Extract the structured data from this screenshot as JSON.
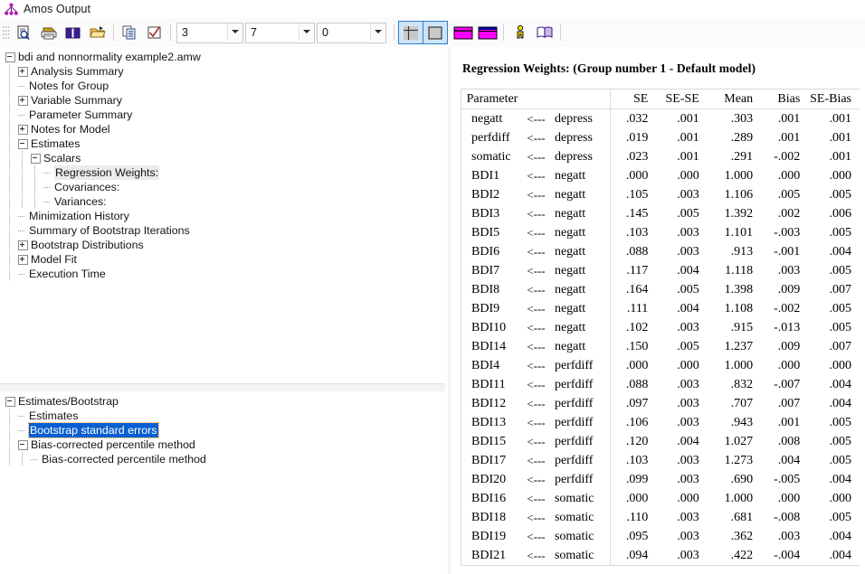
{
  "window": {
    "title": "Amos Output",
    "icon": "amos-path-diagram-icon"
  },
  "toolbar": {
    "buttons": [
      {
        "name": "print-preview-icon",
        "label": "Print Preview"
      },
      {
        "name": "print-icon",
        "label": "Print"
      },
      {
        "name": "book-icon",
        "label": "Help Contents"
      },
      {
        "name": "open-folder-icon",
        "label": "Open File"
      },
      {
        "name": "copy-icon",
        "label": "Copy to Clipboard"
      },
      {
        "name": "checkbox-icon",
        "label": "Options"
      }
    ],
    "combos": [
      {
        "name": "decimal-places-combo",
        "value": "3"
      },
      {
        "name": "significant-digits-combo",
        "value": "7"
      },
      {
        "name": "zero-format-combo",
        "value": "0"
      }
    ],
    "toggles": [
      {
        "name": "tree-view-toggle",
        "icon": "crosshair-icon",
        "selected": true
      },
      {
        "name": "text-view-toggle",
        "icon": "page-icon",
        "selected": true
      },
      {
        "name": "table-format-1-icon",
        "label": "Table Format 1"
      },
      {
        "name": "table-format-2-icon",
        "label": "Table Format 2"
      }
    ],
    "right_buttons": [
      {
        "name": "person-icon",
        "label": "Group"
      },
      {
        "name": "open-book-icon",
        "label": "Model"
      }
    ]
  },
  "tree_top": {
    "items": [
      {
        "label": "bdi and nonnormality example2.amw",
        "depth": 0,
        "marker": "minus"
      },
      {
        "label": "Analysis Summary",
        "depth": 1,
        "marker": "plus"
      },
      {
        "label": "Notes for Group",
        "depth": 1,
        "marker": "leaf"
      },
      {
        "label": "Variable Summary",
        "depth": 1,
        "marker": "plus"
      },
      {
        "label": "Parameter Summary",
        "depth": 1,
        "marker": "leaf"
      },
      {
        "label": "Notes for Model",
        "depth": 1,
        "marker": "plus"
      },
      {
        "label": "Estimates",
        "depth": 1,
        "marker": "minus"
      },
      {
        "label": "Scalars",
        "depth": 2,
        "marker": "minus"
      },
      {
        "label": "Regression Weights:",
        "depth": 3,
        "marker": "leaf",
        "state": "shaded"
      },
      {
        "label": "Covariances:",
        "depth": 3,
        "marker": "leaf"
      },
      {
        "label": "Variances:",
        "depth": 3,
        "marker": "leaf"
      },
      {
        "label": "Minimization History",
        "depth": 1,
        "marker": "leaf"
      },
      {
        "label": "Summary of Bootstrap Iterations",
        "depth": 1,
        "marker": "leaf"
      },
      {
        "label": "Bootstrap Distributions",
        "depth": 1,
        "marker": "plus"
      },
      {
        "label": "Model Fit",
        "depth": 1,
        "marker": "plus"
      },
      {
        "label": "Execution Time",
        "depth": 1,
        "marker": "leaf"
      }
    ]
  },
  "tree_bottom": {
    "items": [
      {
        "label": "Estimates/Bootstrap",
        "depth": 0,
        "marker": "minus"
      },
      {
        "label": "Estimates",
        "depth": 1,
        "marker": "leaf"
      },
      {
        "label": "Bootstrap standard errors",
        "depth": 1,
        "marker": "leaf",
        "state": "selected"
      },
      {
        "label": "Bias-corrected percentile method",
        "depth": 1,
        "marker": "minus"
      },
      {
        "label": "Bias-corrected percentile method",
        "depth": 2,
        "marker": "leaf"
      }
    ]
  },
  "output": {
    "heading": "Regression Weights: (Group number 1 - Default model)",
    "table": {
      "headers": [
        "Parameter",
        "",
        "",
        "SE",
        "SE-SE",
        "Mean",
        "Bias",
        "SE-Bias"
      ],
      "arrow": "<---",
      "rows": [
        {
          "from": "negatt",
          "to": "depress",
          "se": ".032",
          "sese": ".001",
          "mean": ".303",
          "bias": ".001",
          "sebias": ".001"
        },
        {
          "from": "perfdiff",
          "to": "depress",
          "se": ".019",
          "sese": ".001",
          "mean": ".289",
          "bias": ".001",
          "sebias": ".001"
        },
        {
          "from": "somatic",
          "to": "depress",
          "se": ".023",
          "sese": ".001",
          "mean": ".291",
          "bias": "-.002",
          "sebias": ".001"
        },
        {
          "from": "BDI1",
          "to": "negatt",
          "se": ".000",
          "sese": ".000",
          "mean": "1.000",
          "bias": ".000",
          "sebias": ".000"
        },
        {
          "from": "BDI2",
          "to": "negatt",
          "se": ".105",
          "sese": ".003",
          "mean": "1.106",
          "bias": ".005",
          "sebias": ".005"
        },
        {
          "from": "BDI3",
          "to": "negatt",
          "se": ".145",
          "sese": ".005",
          "mean": "1.392",
          "bias": ".002",
          "sebias": ".006"
        },
        {
          "from": "BDI5",
          "to": "negatt",
          "se": ".103",
          "sese": ".003",
          "mean": "1.101",
          "bias": "-.003",
          "sebias": ".005"
        },
        {
          "from": "BDI6",
          "to": "negatt",
          "se": ".088",
          "sese": ".003",
          "mean": ".913",
          "bias": "-.001",
          "sebias": ".004"
        },
        {
          "from": "BDI7",
          "to": "negatt",
          "se": ".117",
          "sese": ".004",
          "mean": "1.118",
          "bias": ".003",
          "sebias": ".005"
        },
        {
          "from": "BDI8",
          "to": "negatt",
          "se": ".164",
          "sese": ".005",
          "mean": "1.398",
          "bias": ".009",
          "sebias": ".007"
        },
        {
          "from": "BDI9",
          "to": "negatt",
          "se": ".111",
          "sese": ".004",
          "mean": "1.108",
          "bias": "-.002",
          "sebias": ".005"
        },
        {
          "from": "BDI10",
          "to": "negatt",
          "se": ".102",
          "sese": ".003",
          "mean": ".915",
          "bias": "-.013",
          "sebias": ".005"
        },
        {
          "from": "BDI14",
          "to": "negatt",
          "se": ".150",
          "sese": ".005",
          "mean": "1.237",
          "bias": ".009",
          "sebias": ".007"
        },
        {
          "from": "BDI4",
          "to": "perfdiff",
          "se": ".000",
          "sese": ".000",
          "mean": "1.000",
          "bias": ".000",
          "sebias": ".000"
        },
        {
          "from": "BDI11",
          "to": "perfdiff",
          "se": ".088",
          "sese": ".003",
          "mean": ".832",
          "bias": "-.007",
          "sebias": ".004"
        },
        {
          "from": "BDI12",
          "to": "perfdiff",
          "se": ".097",
          "sese": ".003",
          "mean": ".707",
          "bias": ".007",
          "sebias": ".004"
        },
        {
          "from": "BDI13",
          "to": "perfdiff",
          "se": ".106",
          "sese": ".003",
          "mean": ".943",
          "bias": ".001",
          "sebias": ".005"
        },
        {
          "from": "BDI15",
          "to": "perfdiff",
          "se": ".120",
          "sese": ".004",
          "mean": "1.027",
          "bias": ".008",
          "sebias": ".005"
        },
        {
          "from": "BDI17",
          "to": "perfdiff",
          "se": ".103",
          "sese": ".003",
          "mean": "1.273",
          "bias": ".004",
          "sebias": ".005"
        },
        {
          "from": "BDI20",
          "to": "perfdiff",
          "se": ".099",
          "sese": ".003",
          "mean": ".690",
          "bias": "-.005",
          "sebias": ".004"
        },
        {
          "from": "BDI16",
          "to": "somatic",
          "se": ".000",
          "sese": ".000",
          "mean": "1.000",
          "bias": ".000",
          "sebias": ".000"
        },
        {
          "from": "BDI18",
          "to": "somatic",
          "se": ".110",
          "sese": ".003",
          "mean": ".681",
          "bias": "-.008",
          "sebias": ".005"
        },
        {
          "from": "BDI19",
          "to": "somatic",
          "se": ".095",
          "sese": ".003",
          "mean": ".362",
          "bias": ".003",
          "sebias": ".004"
        },
        {
          "from": "BDI21",
          "to": "somatic",
          "se": ".094",
          "sese": ".003",
          "mean": ".422",
          "bias": "-.004",
          "sebias": ".004"
        }
      ]
    }
  },
  "colors": {
    "accent_magenta": "#ff00ff",
    "selection_blue": "#0a5fd0",
    "toggle_fill": "#cfe4f7",
    "toggle_border": "#2f7fd0",
    "icon_purple": "#9b1f9b"
  }
}
